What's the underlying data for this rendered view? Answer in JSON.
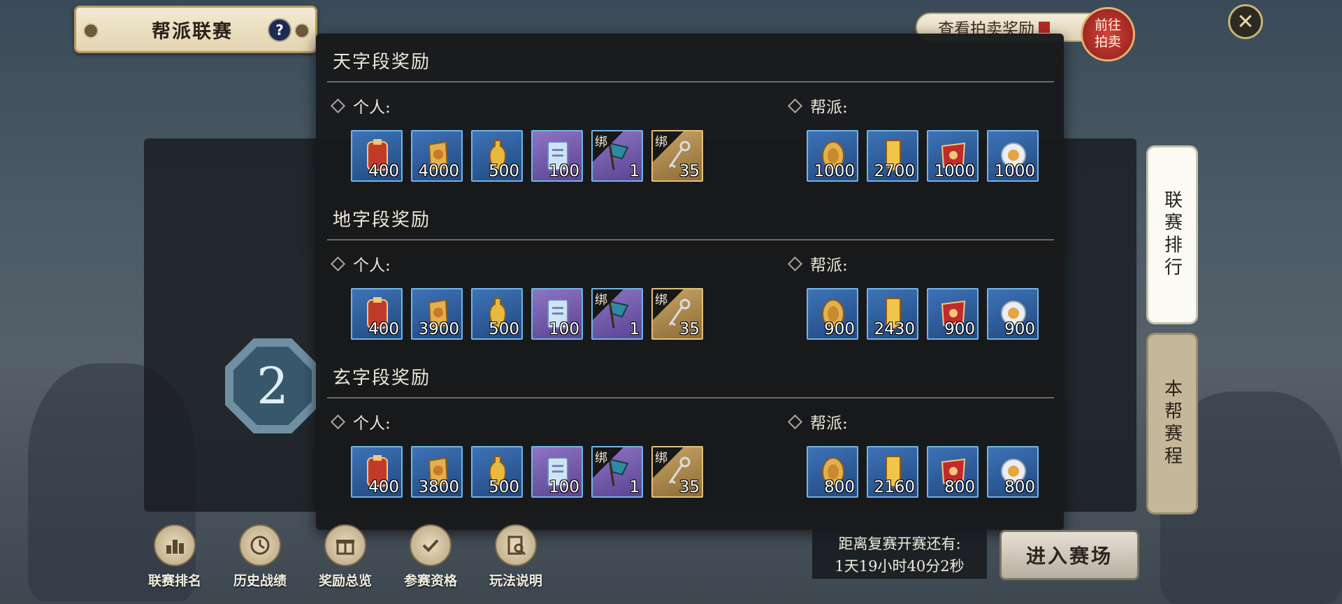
{
  "header": {
    "title": "帮派联赛",
    "help": "?"
  },
  "auction": {
    "label": "查看拍卖奖励",
    "go_label": "前往\n拍卖"
  },
  "side_tabs": [
    "联赛排行",
    "本帮赛程"
  ],
  "rank_badge": "2",
  "modal": {
    "tiers": [
      {
        "title": "天字段奖励",
        "personal_label": "个人:",
        "guild_label": "帮派:",
        "personal": [
          {
            "icon": "red-token-icon",
            "qty": "400",
            "frame": "blue",
            "bound": false
          },
          {
            "icon": "gold-tag-icon",
            "qty": "4000",
            "frame": "blue",
            "bound": false
          },
          {
            "icon": "gold-bottle-icon",
            "qty": "500",
            "frame": "blue",
            "bound": false
          },
          {
            "icon": "scroll-icon",
            "qty": "100",
            "frame": "purple",
            "bound": false
          },
          {
            "icon": "flag-icon",
            "qty": "1",
            "frame": "purple",
            "bound": true
          },
          {
            "icon": "key-icon",
            "qty": "35",
            "frame": "gold",
            "bound": true
          }
        ],
        "guild": [
          {
            "icon": "gold-medal-icon",
            "qty": "1000",
            "frame": "blue"
          },
          {
            "icon": "gold-plaque-icon",
            "qty": "2700",
            "frame": "blue"
          },
          {
            "icon": "red-banner-icon",
            "qty": "1000",
            "frame": "blue"
          },
          {
            "icon": "silver-coin-icon",
            "qty": "1000",
            "frame": "blue"
          }
        ]
      },
      {
        "title": "地字段奖励",
        "personal_label": "个人:",
        "guild_label": "帮派:",
        "personal": [
          {
            "icon": "red-token-icon",
            "qty": "400",
            "frame": "blue",
            "bound": false
          },
          {
            "icon": "gold-tag-icon",
            "qty": "3900",
            "frame": "blue",
            "bound": false
          },
          {
            "icon": "gold-bottle-icon",
            "qty": "500",
            "frame": "blue",
            "bound": false
          },
          {
            "icon": "scroll-icon",
            "qty": "100",
            "frame": "purple",
            "bound": false
          },
          {
            "icon": "flag-icon",
            "qty": "1",
            "frame": "purple",
            "bound": true
          },
          {
            "icon": "key-icon",
            "qty": "35",
            "frame": "gold",
            "bound": true
          }
        ],
        "guild": [
          {
            "icon": "gold-medal-icon",
            "qty": "900",
            "frame": "blue"
          },
          {
            "icon": "gold-plaque-icon",
            "qty": "2430",
            "frame": "blue"
          },
          {
            "icon": "red-banner-icon",
            "qty": "900",
            "frame": "blue"
          },
          {
            "icon": "silver-coin-icon",
            "qty": "900",
            "frame": "blue"
          }
        ]
      },
      {
        "title": "玄字段奖励",
        "personal_label": "个人:",
        "guild_label": "帮派:",
        "personal": [
          {
            "icon": "red-token-icon",
            "qty": "400",
            "frame": "blue",
            "bound": false
          },
          {
            "icon": "gold-tag-icon",
            "qty": "3800",
            "frame": "blue",
            "bound": false
          },
          {
            "icon": "gold-bottle-icon",
            "qty": "500",
            "frame": "blue",
            "bound": false
          },
          {
            "icon": "scroll-icon",
            "qty": "100",
            "frame": "purple",
            "bound": false
          },
          {
            "icon": "flag-icon",
            "qty": "1",
            "frame": "purple",
            "bound": true
          },
          {
            "icon": "key-icon",
            "qty": "35",
            "frame": "gold",
            "bound": true
          }
        ],
        "guild": [
          {
            "icon": "gold-medal-icon",
            "qty": "800",
            "frame": "blue"
          },
          {
            "icon": "gold-plaque-icon",
            "qty": "2160",
            "frame": "blue"
          },
          {
            "icon": "red-banner-icon",
            "qty": "800",
            "frame": "blue"
          },
          {
            "icon": "silver-coin-icon",
            "qty": "800",
            "frame": "blue"
          }
        ]
      }
    ],
    "bind_tag": "绑"
  },
  "bottom_buttons": [
    {
      "label": "联赛排名",
      "icon": "ranking-icon"
    },
    {
      "label": "历史战绩",
      "icon": "history-icon"
    },
    {
      "label": "奖励总览",
      "icon": "gift-icon"
    },
    {
      "label": "参赛资格",
      "icon": "qualification-icon"
    },
    {
      "label": "玩法说明",
      "icon": "rules-icon"
    }
  ],
  "countdown": {
    "label": "距离复赛开赛还有:",
    "value": "1天19小时40分2秒"
  },
  "enter_button": "进入赛场"
}
